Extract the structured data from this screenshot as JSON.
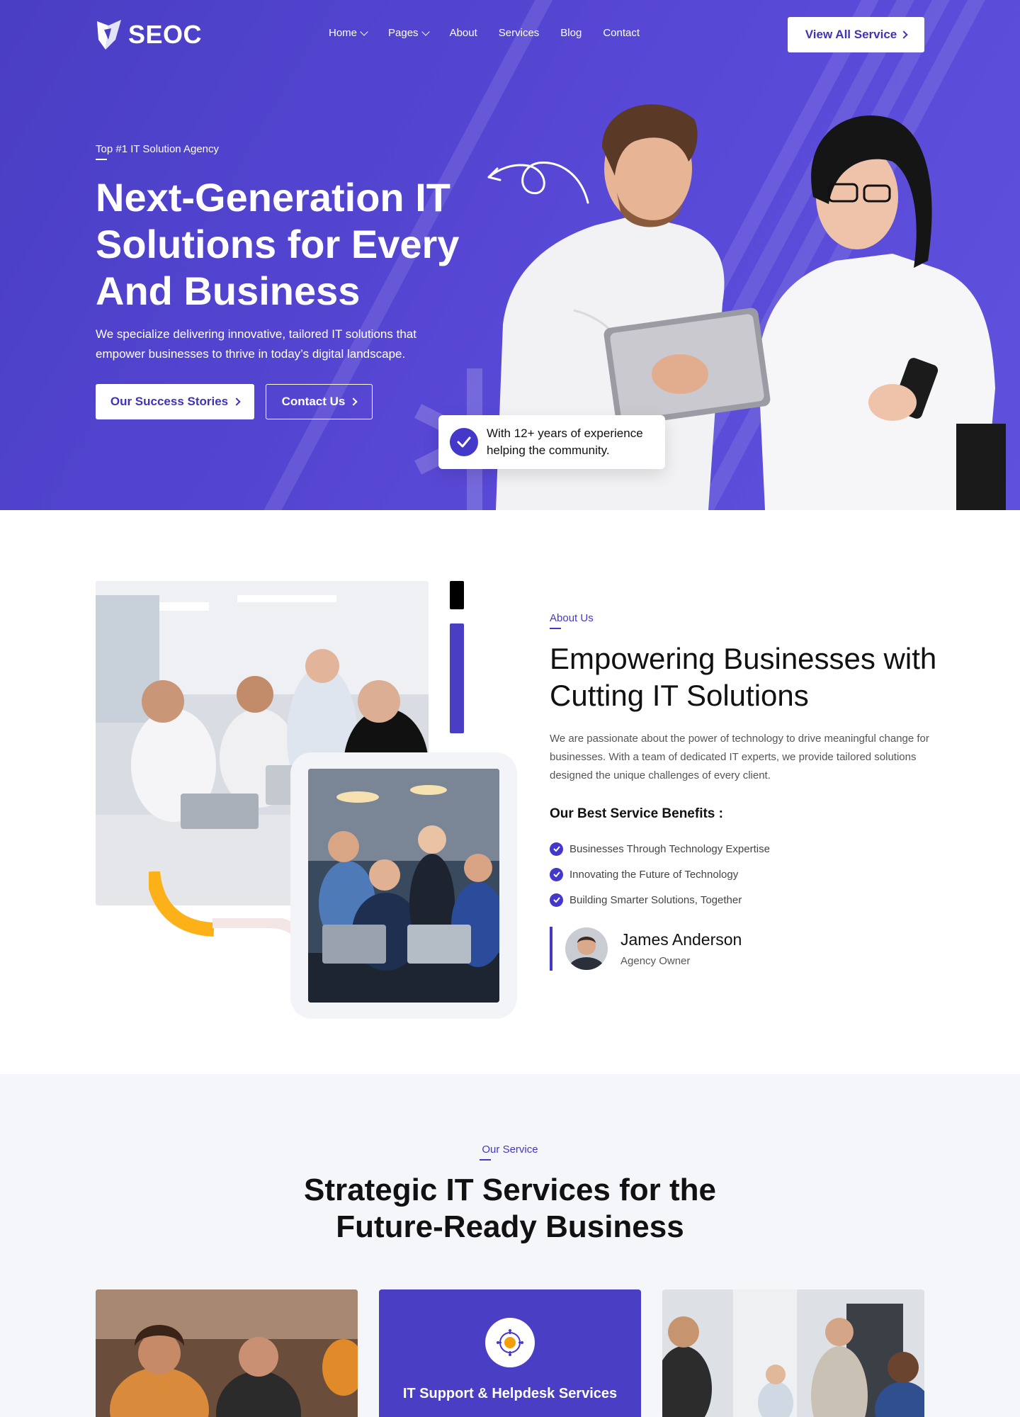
{
  "brand": {
    "name": "SEOC"
  },
  "nav": {
    "items": [
      {
        "label": "Home",
        "dropdown": true
      },
      {
        "label": "Pages",
        "dropdown": true
      },
      {
        "label": "About",
        "dropdown": false
      },
      {
        "label": "Services",
        "dropdown": false
      },
      {
        "label": "Blog",
        "dropdown": false
      },
      {
        "label": "Contact",
        "dropdown": false
      }
    ],
    "cta_label": "View All Service"
  },
  "hero": {
    "tag": "Top #1 IT Solution Agency",
    "title": "Next-Generation IT Solutions for Every And Business",
    "description": "We specialize delivering innovative, tailored IT solutions that empower businesses to thrive in today’s digital landscape.",
    "primary_button": "Our Success Stories",
    "secondary_button": "Contact Us",
    "experience_text": "With 12+ years of experience helping the community."
  },
  "about": {
    "tag": "About Us",
    "title": "Empowering Businesses with Cutting IT Solutions",
    "description": "We are passionate about the power of technology to drive meaningful change for businesses. With a team of dedicated IT experts, we provide tailored solutions designed  the unique challenges of every client.",
    "benefits_title": "Our Best Service Benefits :",
    "benefits": [
      "Businesses Through Technology Expertise",
      "Innovating the Future of Technology",
      "Building Smarter Solutions, Together"
    ],
    "owner": {
      "name": "James Anderson",
      "role": "Agency Owner"
    }
  },
  "services": {
    "tag": "Our Service",
    "title": "Strategic IT Services for the Future-Ready Business",
    "cards": [
      {
        "title": ""
      },
      {
        "title": "IT Support & Helpdesk Services",
        "icon": "support-icon"
      },
      {
        "title": ""
      }
    ]
  },
  "colors": {
    "brand_purple": "#4a3ec4",
    "accent_indigo": "#4338ca",
    "accent_yellow": "#fbb117",
    "light_bg": "#f5f6fa"
  }
}
